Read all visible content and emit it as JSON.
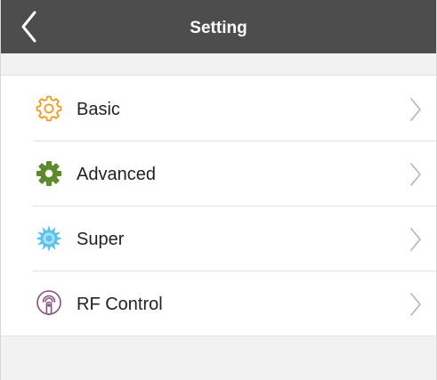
{
  "header": {
    "title": "Setting"
  },
  "menu": {
    "items": [
      {
        "label": "Basic",
        "icon": "gear-outline-icon",
        "color": "#f39a1e"
      },
      {
        "label": "Advanced",
        "icon": "gear-solid-icon",
        "color": "#5d8a2a"
      },
      {
        "label": "Super",
        "icon": "sunburst-gear-icon",
        "color": "#5cc2ea"
      },
      {
        "label": "RF Control",
        "icon": "rf-remote-icon",
        "color": "#8a4f7d"
      }
    ]
  },
  "colors": {
    "header_bg": "#4d4d4d",
    "page_bg": "#f2f2f2",
    "chevron": "#b5b5b5"
  }
}
